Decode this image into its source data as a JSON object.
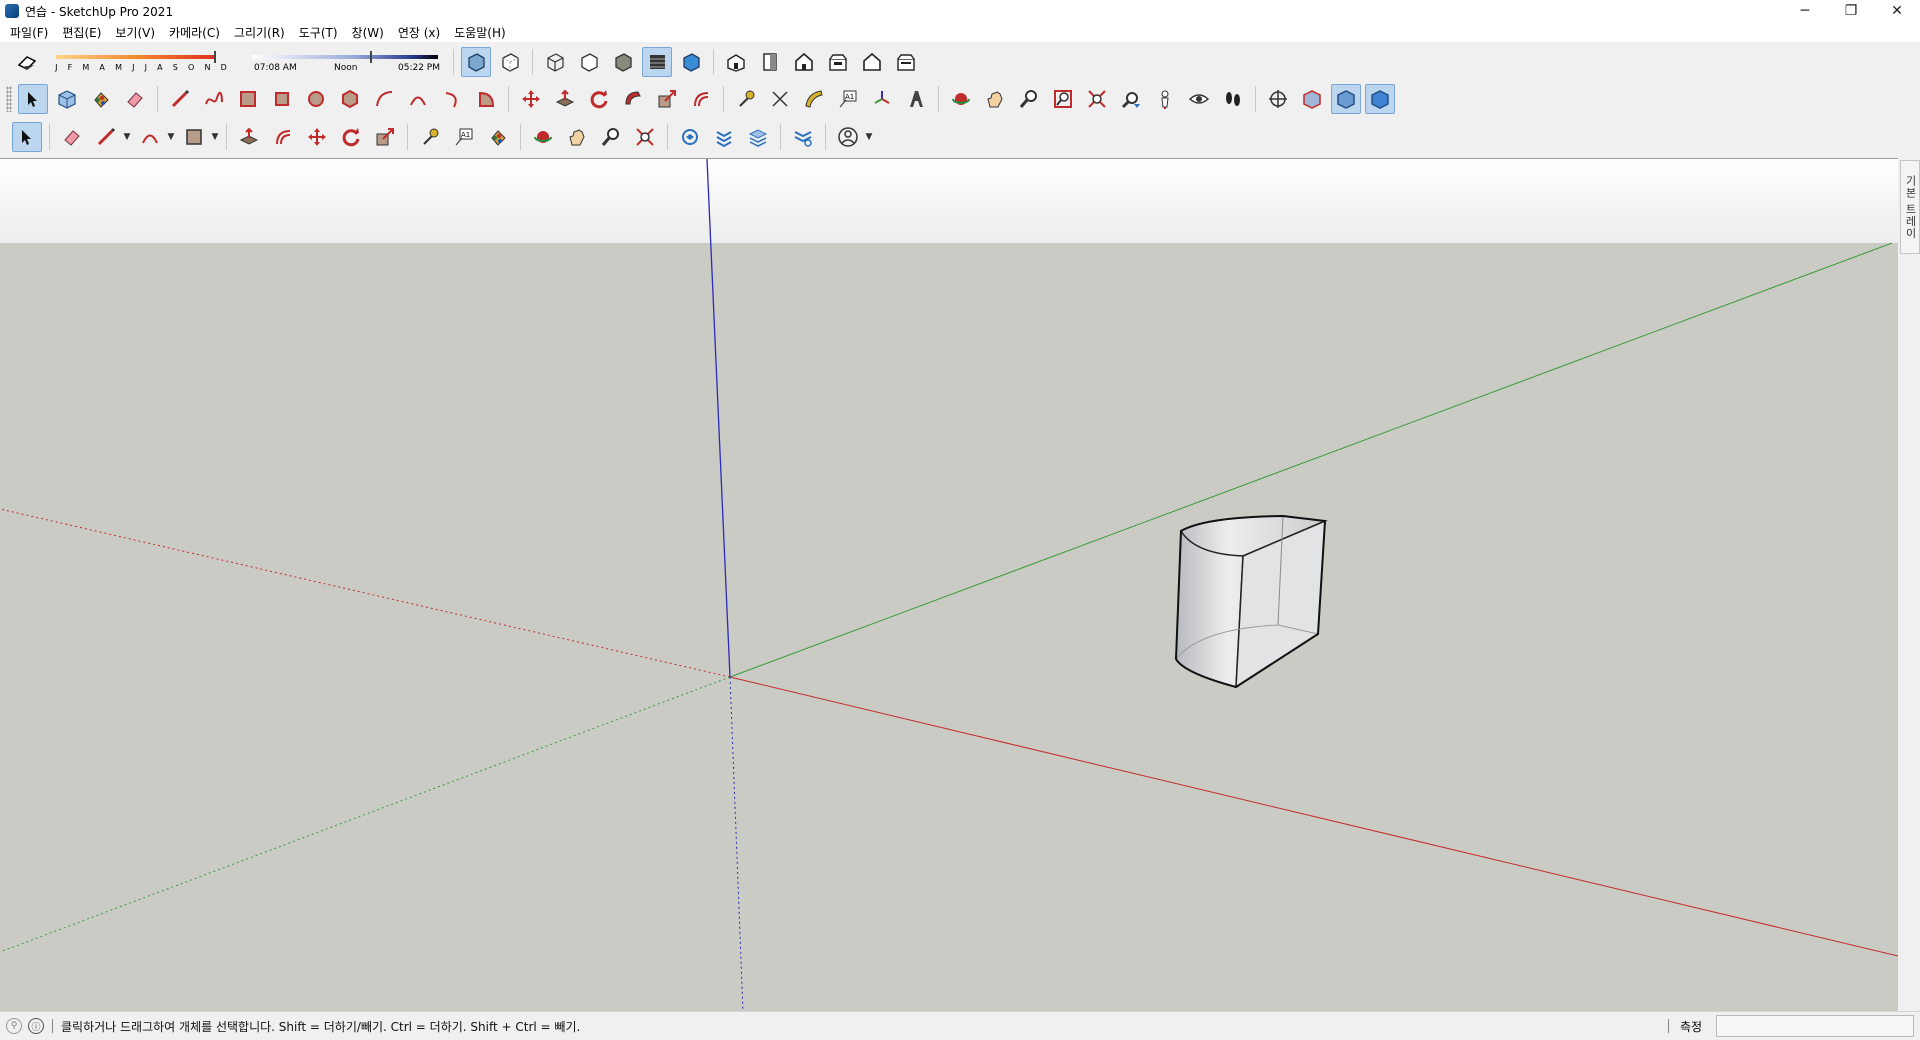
{
  "window": {
    "title": "연습 - SketchUp Pro 2021",
    "controls": {
      "minimize": "─",
      "restore": "❐",
      "close": "✕"
    }
  },
  "menu": [
    {
      "label": "파일(F)"
    },
    {
      "label": "편집(E)"
    },
    {
      "label": "보기(V)"
    },
    {
      "label": "카메라(C)"
    },
    {
      "label": "그리기(R)"
    },
    {
      "label": "도구(T)"
    },
    {
      "label": "창(W)"
    },
    {
      "label": "연장 (x)"
    },
    {
      "label": "도움말(H)"
    }
  ],
  "shadows": {
    "months": [
      "J",
      "F",
      "M",
      "A",
      "M",
      "J",
      "J",
      "A",
      "S",
      "O",
      "N",
      "D"
    ],
    "time_start": "07:08 AM",
    "time_mid": "Noon",
    "time_end": "05:22 PM"
  },
  "toolbar_row1": {
    "styles": [
      "x-ray-style",
      "back-edges-style",
      "wireframe-style",
      "hidden-line-style",
      "shaded-style",
      "shaded-textures-style",
      "monochrome-style"
    ],
    "views": [
      "iso-view",
      "top-view",
      "front-view",
      "right-view",
      "back-view",
      "left-view"
    ]
  },
  "toolbar_row2": [
    "select",
    "component",
    "paint-bucket",
    "eraser",
    "line",
    "freehand",
    "rectangle",
    "rotated-rectangle",
    "circle",
    "polygon",
    "arc",
    "two-point-arc",
    "three-point-arc",
    "pie",
    "move",
    "push-pull",
    "rotate",
    "follow-me",
    "scale",
    "offset",
    "tape-measure",
    "dimension",
    "protractor",
    "text",
    "axes",
    "3d-text",
    "orbit",
    "pan",
    "zoom",
    "zoom-window",
    "zoom-extents",
    "previous",
    "position-camera",
    "look-around",
    "walk",
    "section-plane",
    "section-display",
    "section-cut",
    "section-fill"
  ],
  "toolbar_row3": [
    "select",
    "eraser",
    "line",
    "arc",
    "shapes",
    "push-pull",
    "offset",
    "move",
    "rotate",
    "scale",
    "tape-measure",
    "text",
    "paint-bucket",
    "orbit",
    "pan",
    "zoom",
    "zoom-extents",
    "warehouse",
    "extension-warehouse",
    "layout",
    "extension-manager",
    "profile"
  ],
  "tray": {
    "label": "기본 트레이"
  },
  "status": {
    "message": "클릭하거나 드래그하여 개체를 선택합니다. Shift = 더하기/빼기. Ctrl = 더하기. Shift + Ctrl = 빼기.",
    "measure_label": "측정",
    "measure_value": ""
  },
  "colors": {
    "sky": "#f2f3f4",
    "ground": "#cbcbc6",
    "axis_red": "#c42b2b",
    "axis_green": "#3a9a3a",
    "axis_blue": "#2b2bb8",
    "model_face": "#d9dadc"
  }
}
